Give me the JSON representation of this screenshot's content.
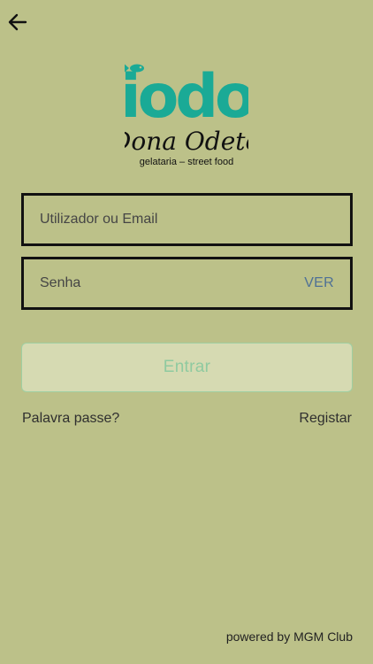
{
  "nav": {
    "back_icon": "arrow-left-icon"
  },
  "brand": {
    "wordmark": "iodo",
    "name": "Dona Odete",
    "tagline": "gelataria – street food",
    "logo_color": "#1aaa96",
    "logo_icon": "fish-icon"
  },
  "form": {
    "username_placeholder": "Utilizador ou Email",
    "password_placeholder": "Senha",
    "show_password_label": "VER",
    "submit_label": "Entrar"
  },
  "links": {
    "forgot_password": "Palavra passe?",
    "register": "Registar"
  },
  "footer": {
    "powered_by": "powered by MGM Club"
  },
  "colors": {
    "background": "#bcc189",
    "accent_link": "#4f7196",
    "button_text_disabled": "#8fcaa0",
    "button_border": "#9fcfa2"
  }
}
